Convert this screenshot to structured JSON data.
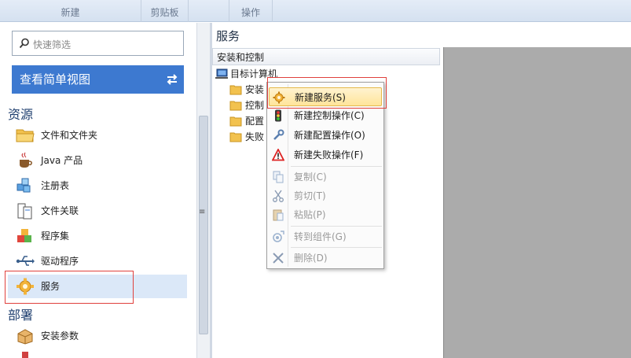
{
  "ribbon": {
    "groups": [
      "新建",
      "剪贴板",
      "",
      "操作"
    ]
  },
  "sidebar": {
    "filter_placeholder": "快速筛选",
    "simple_view_label": "查看简单视图",
    "sections": {
      "resources": "资源",
      "deploy": "部署"
    },
    "items": [
      {
        "label": "文件和文件夹",
        "icon": "folder-icon"
      },
      {
        "label": "Java 产品",
        "icon": "java-cup-icon"
      },
      {
        "label": "注册表",
        "icon": "registry-cubes-icon"
      },
      {
        "label": "文件关联",
        "icon": "file-association-icon"
      },
      {
        "label": "程序集",
        "icon": "assembly-blocks-icon"
      },
      {
        "label": "驱动程序",
        "icon": "usb-driver-icon"
      },
      {
        "label": "服务",
        "icon": "service-gear-icon",
        "selected": true
      },
      {
        "label": "安装参数",
        "icon": "install-parameters-icon"
      }
    ]
  },
  "main": {
    "title": "服务",
    "column_header": "安装和控制",
    "tree": {
      "root": "目标计算机",
      "children": [
        "安装",
        "控制",
        "配置",
        "失败"
      ]
    }
  },
  "context_menu": {
    "items": [
      {
        "label": "新建服务(S)",
        "icon": "new-service-icon",
        "enabled": true,
        "highlighted": true
      },
      {
        "label": "新建控制操作(C)",
        "icon": "traffic-light-icon",
        "enabled": true
      },
      {
        "label": "新建配置操作(O)",
        "icon": "wrench-icon",
        "enabled": true
      },
      {
        "label": "新建失败操作(F)",
        "icon": "warning-icon",
        "enabled": true
      },
      {
        "label": "复制(C)",
        "icon": "copy-icon",
        "enabled": false
      },
      {
        "label": "剪切(T)",
        "icon": "scissors-icon",
        "enabled": false
      },
      {
        "label": "粘贴(P)",
        "icon": "paste-icon",
        "enabled": false
      },
      {
        "label": "转到组件(G)",
        "icon": "goto-component-icon",
        "enabled": false
      },
      {
        "label": "删除(D)",
        "icon": "delete-x-icon",
        "enabled": false
      }
    ]
  },
  "colors": {
    "accent": "#3d79d0",
    "highlight_box": "#e0413d",
    "selected_row": "#dbe8f8",
    "menu_highlight": "#ffe49a"
  }
}
